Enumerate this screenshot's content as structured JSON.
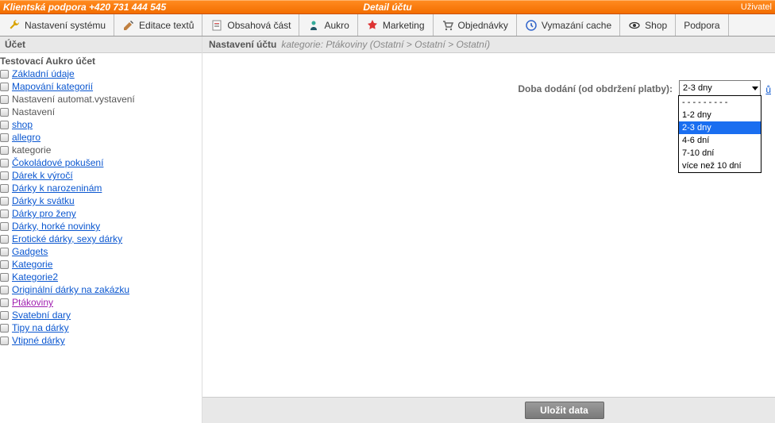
{
  "topbar": {
    "left": "Klientská podpora +420 731 444 545",
    "center": "Detail účtu",
    "right": "Uživatel"
  },
  "menu": [
    {
      "label": "Nastavení systému",
      "icon": "wrench"
    },
    {
      "label": "Editace textů",
      "icon": "pencil"
    },
    {
      "label": "Obsahová část",
      "icon": "page"
    },
    {
      "label": "Aukro",
      "icon": "person"
    },
    {
      "label": "Marketing",
      "icon": "star"
    },
    {
      "label": "Objednávky",
      "icon": "cart"
    },
    {
      "label": "Vymazání cache",
      "icon": "clock"
    },
    {
      "label": "Shop",
      "icon": "eye"
    },
    {
      "label": "Podpora",
      "icon": ""
    }
  ],
  "sidebar": {
    "header": "Účet",
    "root": "Testovací Aukro účet",
    "lvl0": [
      {
        "label": "Základní údaje",
        "link": true
      },
      {
        "label": "Mapování kategorií",
        "link": true
      },
      {
        "label": "Nastavení automat.vystavení",
        "link": false
      },
      {
        "label": "Nastavení",
        "link": false
      }
    ],
    "lvl1": [
      {
        "label": "shop"
      },
      {
        "label": "allegro"
      },
      {
        "label": "kategorie",
        "plain": true
      }
    ],
    "lvl2": [
      {
        "label": "Čokoládové pokušení"
      },
      {
        "label": "Dárek k výročí"
      },
      {
        "label": "Dárky k narozeninám"
      },
      {
        "label": "Dárky k svátku"
      },
      {
        "label": "Dárky pro ženy"
      },
      {
        "label": "Dárky, horké novinky"
      },
      {
        "label": "Erotické dárky, sexy dárky"
      },
      {
        "label": "Gadgets"
      },
      {
        "label": "Kategorie"
      },
      {
        "label": "Kategorie2"
      },
      {
        "label": "Originální dárky na zakázku"
      },
      {
        "label": "Ptákoviny",
        "selected": true
      },
      {
        "label": "Svatební dary"
      },
      {
        "label": "Tipy na dárky"
      },
      {
        "label": "Vtipné dárky"
      }
    ]
  },
  "main": {
    "title": "Nastavení účtu",
    "breadcrumb": "kategorie: Ptákoviny (Ostatní > Ostatní > Ostatní)",
    "field_label": "Doba dodání (od obdržení platby):",
    "selected": "2-3 dny",
    "options": [
      "- - - - - - - - -",
      "1-2 dny",
      "2-3 dny",
      "4-6 dní",
      "7-10 dní",
      "více než 10 dní"
    ],
    "partial_link": "ů",
    "save": "Uložit data"
  }
}
